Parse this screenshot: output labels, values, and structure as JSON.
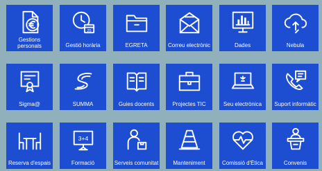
{
  "tiles": [
    {
      "label_line1": "Gestions",
      "label_line2": "personals",
      "icon": "euro-document-icon"
    },
    {
      "label": "Gestió horària",
      "icon": "clock-calendar-icon",
      "calendar_day": "25"
    },
    {
      "label": "EGRETA",
      "icon": "folder-icon"
    },
    {
      "label": "Correu electrònic",
      "icon": "mail-icon"
    },
    {
      "label": "Dades",
      "icon": "bar-chart-monitor-icon"
    },
    {
      "label": "Nebula",
      "icon": "cloud-sync-icon"
    },
    {
      "label": "Sigma@",
      "icon": "certificate-icon"
    },
    {
      "label": "SUMMA",
      "icon": "summa-logo-icon"
    },
    {
      "label": "Guies docents",
      "icon": "open-book-icon"
    },
    {
      "label": "Projectes TIC",
      "icon": "briefcase-icon"
    },
    {
      "label": "Seu electrònica",
      "icon": "laptop-icon"
    },
    {
      "label": "Suport informàtic",
      "icon": "phone-chat-icon"
    },
    {
      "label": "Reserva d'espais",
      "icon": "table-chairs-icon"
    },
    {
      "label": "Formació",
      "icon": "blackboard-icon",
      "board_text": "3+4"
    },
    {
      "label": "Serveis comunitat",
      "icon": "person-box-icon"
    },
    {
      "label": "Manteniment",
      "icon": "traffic-cone-icon"
    },
    {
      "label": "Comissió d'Ètica",
      "icon": "heart-pulse-icon"
    },
    {
      "label": "Convenis",
      "icon": "podium-speaker-icon"
    }
  ],
  "colors": {
    "background": "#90b0bb",
    "tile": "#1d4ed2",
    "foreground": "#ffffff"
  }
}
